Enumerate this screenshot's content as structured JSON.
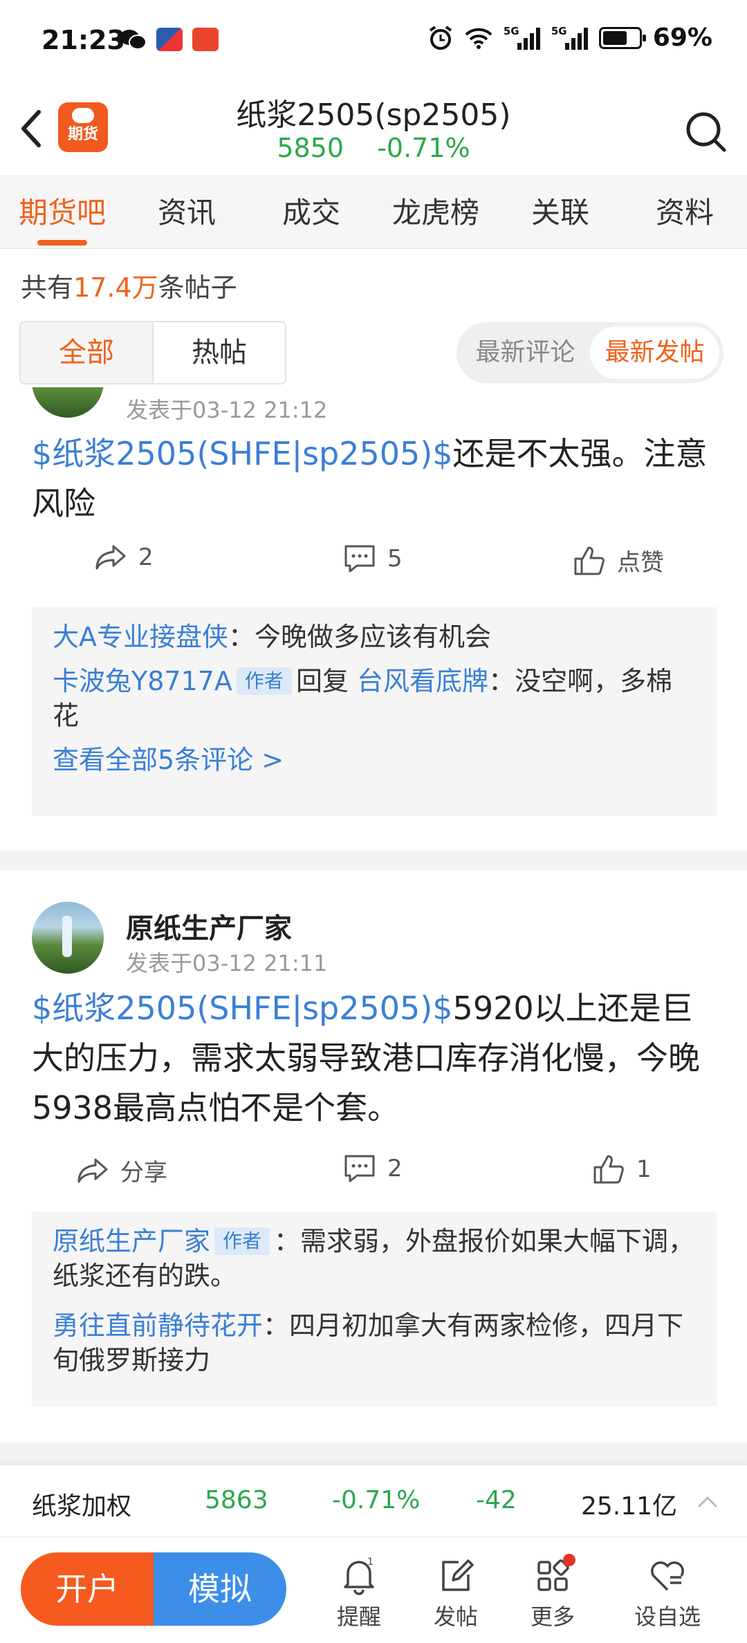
{
  "status_bar": {
    "time": "21:23",
    "battery": "69%",
    "signal1": "5G",
    "signal2": "5G"
  },
  "header": {
    "title": "纸浆2505(sp2505)",
    "price": "5850",
    "change": "-0.71%",
    "logo_label": "期货"
  },
  "tabs": [
    {
      "label": "期货吧",
      "active": true
    },
    {
      "label": "资讯"
    },
    {
      "label": "成交"
    },
    {
      "label": "龙虎榜"
    },
    {
      "label": "关联"
    },
    {
      "label": "资料"
    }
  ],
  "post_count": {
    "prefix": "共有",
    "number": "17.4万",
    "suffix": "条帖子"
  },
  "filter": {
    "all": "全部",
    "hot": "热帖"
  },
  "sort": {
    "latest_comment": "最新评论",
    "latest_post": "最新发帖"
  },
  "posts": [
    {
      "time": "发表于03-12 21:12",
      "tag": "$纸浆2505(SHFE|sp2505)$",
      "text": "还是不太强。注意风险",
      "share": "2",
      "comments": "5",
      "likes": "点赞",
      "replies": [
        {
          "user": "大A专业接盘侠",
          "text": "：今晚做多应该有机会"
        },
        {
          "user": "卡波兔Y8717A",
          "badge": "作者",
          "reply_word": "回复",
          "reply_to": "台风看底牌",
          "text": "：没空啊，多棉花"
        }
      ],
      "view_all": "查看全部5条评论 >"
    },
    {
      "author": "原纸生产厂家",
      "time": "发表于03-12 21:11",
      "tag": "$纸浆2505(SHFE|sp2505)$",
      "text": "5920以上还是巨大的压力，需求太弱导致港口库存消化慢，今晚5938最高点怕不是个套。",
      "share": "分享",
      "comments": "2",
      "likes": "1",
      "replies": [
        {
          "user": "原纸生产厂家",
          "badge": "作者",
          "text": "：需求弱，外盘报价如果大幅下调，纸浆还有的跌。"
        },
        {
          "user": "勇往直前静待花开",
          "text": "：四月初加拿大有两家检修，四月下旬俄罗斯接力"
        }
      ]
    }
  ],
  "quote_bar": {
    "name": "纸浆加权",
    "price": "5863",
    "pct": "-0.71%",
    "chg": "-42",
    "volume": "25.11亿"
  },
  "bottom_nav": {
    "open": "开户",
    "simulate": "模拟",
    "remind": "提醒",
    "post": "发帖",
    "more": "更多",
    "watch": "设自选",
    "remind_count": "1"
  },
  "colors": {
    "accent": "#f0611b",
    "link": "#3a7fd5",
    "down": "#2aa84a",
    "sim": "#3d8ee8"
  }
}
